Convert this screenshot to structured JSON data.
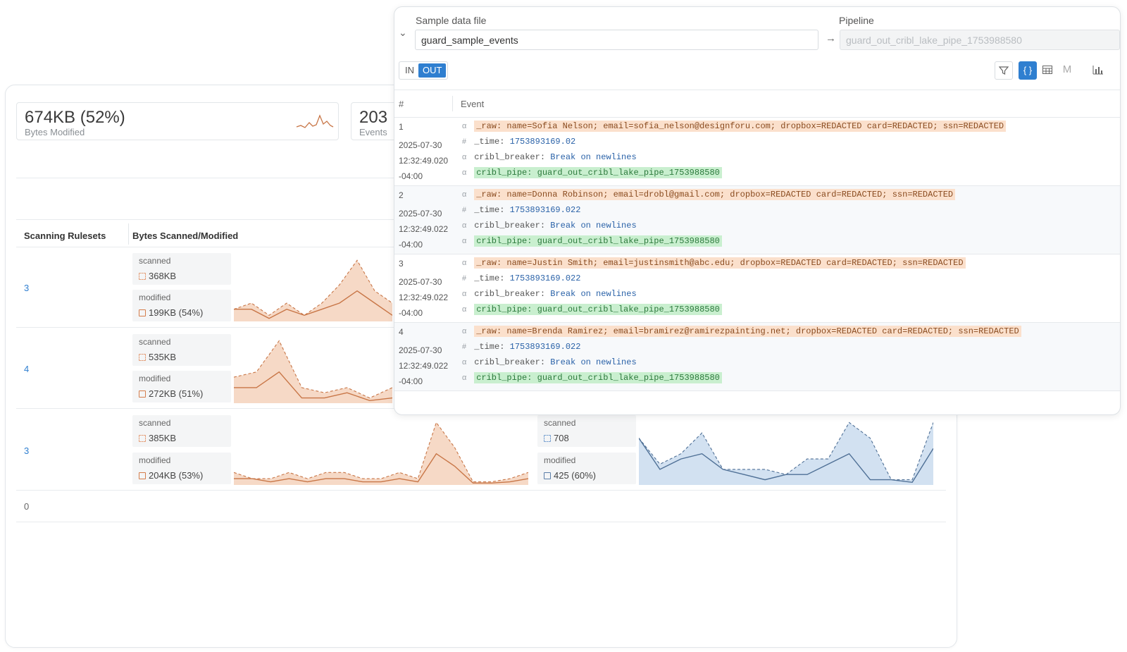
{
  "summary": {
    "bytes_modified_value": "674KB (52%)",
    "bytes_modified_label": "Bytes Modified",
    "events_value": "203",
    "events_label": "Events"
  },
  "table": {
    "col_rulesets": "Scanning Rulesets",
    "col_bytes": "Bytes Scanned/Modified",
    "rows": [
      {
        "rulesets": "3",
        "scanned_label": "scanned",
        "scanned_value": "368KB",
        "modified_label": "modified",
        "modified_value": "199KB (54%)",
        "scanned_series": [
          2,
          3,
          1,
          3,
          1,
          3,
          6,
          10,
          5,
          3
        ],
        "modified_series": [
          2,
          2,
          0.5,
          2,
          1,
          2,
          3,
          5,
          3,
          1
        ]
      },
      {
        "rulesets": "4",
        "scanned_label": "scanned",
        "scanned_value": "535KB",
        "modified_label": "modified",
        "modified_value": "272KB (51%)",
        "scanned_series": [
          5,
          6,
          12,
          3,
          2,
          3,
          1,
          3
        ],
        "modified_series": [
          3,
          3,
          6,
          1,
          1,
          2,
          0.5,
          1
        ]
      },
      {
        "rulesets": "3",
        "scanned_label": "scanned",
        "scanned_value": "385KB",
        "modified_label": "modified",
        "modified_value": "204KB (53%)",
        "scanned_series": [
          2,
          1,
          1,
          2,
          1,
          2,
          2,
          1,
          1,
          2,
          1,
          10,
          6,
          0.5,
          0.5,
          1,
          2
        ],
        "modified_series": [
          1,
          1,
          0.5,
          1,
          0.5,
          1,
          1,
          0.5,
          0.5,
          1,
          0.5,
          5,
          3,
          0.3,
          0.3,
          0.5,
          1
        ],
        "events": {
          "scanned_label": "scanned",
          "scanned_value": "708",
          "modified_label": "modified",
          "modified_value": "425 (60%)",
          "scanned_series": [
            9,
            4,
            6,
            10,
            3,
            3,
            3,
            2,
            5,
            5,
            12,
            9,
            1,
            1,
            12
          ],
          "modified_series": [
            9,
            3,
            5,
            6,
            3,
            2,
            1,
            2,
            2,
            4,
            6,
            1,
            1,
            0.5,
            7
          ]
        }
      },
      {
        "rulesets": "0"
      }
    ]
  },
  "preview": {
    "sample_label": "Sample data file",
    "sample_value": "guard_sample_events",
    "pipeline_label": "Pipeline",
    "pipeline_value": "guard_out_cribl_lake_pipe_1753988580",
    "mode_in": "IN",
    "mode_out": "OUT",
    "col_num": "#",
    "col_event": "Event",
    "tool_m": "M",
    "events": [
      {
        "num": "1",
        "date": "2025-07-30",
        "time": "12:32:49.020",
        "tz": "-04:00",
        "raw_key": "_raw:",
        "raw_val": "name=Sofia Nelson; email=sofia_nelson@designforu.com; dropbox=REDACTED card=REDACTED; ssn=REDACTED",
        "time_key": "_time:",
        "time_val": "1753893169.02",
        "breaker_key": "cribl_breaker:",
        "breaker_val": "Break on newlines",
        "pipe_key": "cribl_pipe:",
        "pipe_val": "guard_out_cribl_lake_pipe_1753988580"
      },
      {
        "num": "2",
        "date": "2025-07-30",
        "time": "12:32:49.022",
        "tz": "-04:00",
        "raw_key": "_raw:",
        "raw_val": "name=Donna Robinson; email=drobl@gmail.com; dropbox=REDACTED card=REDACTED; ssn=REDACTED",
        "time_key": "_time:",
        "time_val": "1753893169.022",
        "breaker_key": "cribl_breaker:",
        "breaker_val": "Break on newlines",
        "pipe_key": "cribl_pipe:",
        "pipe_val": "guard_out_cribl_lake_pipe_1753988580"
      },
      {
        "num": "3",
        "date": "2025-07-30",
        "time": "12:32:49.022",
        "tz": "-04:00",
        "raw_key": "_raw:",
        "raw_val": "name=Justin Smith; email=justinsmith@abc.edu; dropbox=REDACTED card=REDACTED; ssn=REDACTED",
        "time_key": "_time:",
        "time_val": "1753893169.022",
        "breaker_key": "cribl_breaker:",
        "breaker_val": "Break on newlines",
        "pipe_key": "cribl_pipe:",
        "pipe_val": "guard_out_cribl_lake_pipe_1753988580"
      },
      {
        "num": "4",
        "date": "2025-07-30",
        "time": "12:32:49.022",
        "tz": "-04:00",
        "raw_key": "_raw:",
        "raw_val": "name=Brenda Ramirez; email=bramirez@ramirezpainting.net; dropbox=REDACTED card=REDACTED; ssn=REDACTED",
        "time_key": "_time:",
        "time_val": "1753893169.022",
        "breaker_key": "cribl_breaker:",
        "breaker_val": "Break on newlines",
        "pipe_key": "cribl_pipe:",
        "pipe_val": "guard_out_cribl_lake_pipe_1753988580"
      }
    ]
  },
  "colors": {
    "accent": "#2f7fd0",
    "orange_line": "#c87647",
    "orange_fill": "#f6d9c6",
    "blue_line": "#4f7096",
    "blue_fill": "#d2e1f1",
    "raw_highlight": "#fbe0cc",
    "pipe_highlight": "#c9efcf"
  },
  "icons": {
    "collapse": "chevron-down-icon",
    "dropdown": "chevron-down-icon",
    "flow": "arrow-right-icon",
    "filter": "filter-icon",
    "json": "braces-icon",
    "table": "table-icon",
    "chart": "bar-chart-icon"
  }
}
